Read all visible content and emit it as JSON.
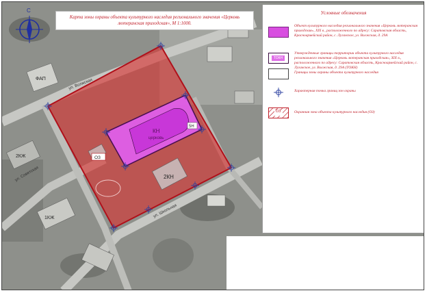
{
  "title": "Карта зоны охраны объекта культурного наследия регионального значения «Церковь лютеранская приходская», М 1:1000.",
  "legend": {
    "title": "Условные обозначения",
    "items": [
      {
        "symbol": "magenta-fill",
        "text": "Объект культурного наследия регионального значения «Церковь лютеранская приходская», XIX в., расположенного по адресу: Саратовская область, Красноармейский район, с. Луганское, ул. Волжская, д. 29А",
        "color": "#d84ee0"
      },
      {
        "symbol": "territory-boundary",
        "label": "ТОКН",
        "text": "Утвержденные границы территории объекта культурного наследия регионального значения «Церковь лютеранская приходская», XIX в., расположенного по адресу: Саратовская область, Красноармейский район, с. Луганское, ул. Волжская, д. 29А (ТОКН)",
        "color": "#e070e8"
      },
      {
        "symbol": "white-box",
        "text": "Границы зоны охраны объекта культурного наследия"
      },
      {
        "symbol": "crosshair",
        "text": "Характерная точка границ зон охраны"
      },
      {
        "symbol": "hatched-red",
        "label": "ОЗ",
        "text": "Охранная зона объекта культурного наследия (ОЗ)",
        "color": "#c0202a"
      }
    ]
  },
  "map_labels": {
    "compass": "С",
    "kn_top": "КН",
    "church": "церковь",
    "kn2": "2КН",
    "oz": "ОЗ",
    "sh_label": "5Н",
    "fap": "ФАП",
    "kzh1": "2КЖ",
    "kzh2": "1КЖ",
    "street_volzhskaya": "ул. Волжская",
    "street_sovetskaya": "ул. Советская",
    "street_shkolnaya": "ул. Школьная"
  },
  "colors": {
    "protection_zone": "#d9312f",
    "territory": "#e060ee",
    "monument": "#c837d8",
    "boundary_line": "#b0101a"
  }
}
